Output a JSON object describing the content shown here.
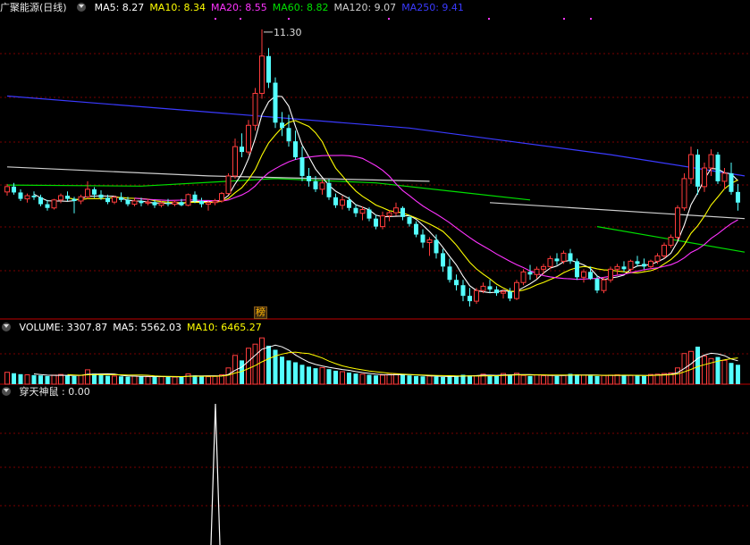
{
  "colors": {
    "up": "#ff3c3c",
    "down": "#54ffff",
    "grid": "#7a0000",
    "separator": "#c00000",
    "ma5": "#ffffff",
    "ma10": "#ffff00",
    "ma20": "#ff33ff",
    "ma60": "#00e000",
    "ma120": "#cfcfcf",
    "ma250": "#3a3aff"
  },
  "price_panel": {
    "title": "广聚能源(日线)",
    "ma_labels": [
      {
        "text": "MA5: 8.27",
        "color": "#ffffff"
      },
      {
        "text": "MA10: 8.34",
        "color": "#ffff00"
      },
      {
        "text": "MA20: 8.55",
        "color": "#ff33ff"
      },
      {
        "text": "MA60: 8.82",
        "color": "#00e000"
      },
      {
        "text": "MA120: 9.07",
        "color": "#cfcfcf"
      },
      {
        "text": "MA250: 9.41",
        "color": "#3a3aff"
      }
    ],
    "high_marker": "11.30",
    "badge": "榜"
  },
  "volume_panel": {
    "labels": [
      {
        "text": "VOLUME: 3307.87",
        "color": "#ffffff"
      },
      {
        "text": "MA5: 5562.03",
        "color": "#ffffff"
      },
      {
        "text": "MA10: 6465.27",
        "color": "#ffff00"
      }
    ]
  },
  "indicator_panel": {
    "label": "穿天神鼠 : 0.00"
  },
  "chart_data": {
    "type": "candlestick",
    "unit_note": "",
    "candles": [
      [
        8.25,
        8.4,
        8.18,
        8.35
      ],
      [
        8.35,
        8.42,
        8.2,
        8.24
      ],
      [
        8.24,
        8.3,
        8.08,
        8.12
      ],
      [
        8.12,
        8.22,
        8.05,
        8.18
      ],
      [
        8.18,
        8.26,
        8.1,
        8.15
      ],
      [
        8.15,
        8.2,
        7.98,
        8.02
      ],
      [
        8.02,
        8.1,
        7.9,
        7.95
      ],
      [
        7.95,
        8.12,
        7.92,
        8.1
      ],
      [
        8.1,
        8.22,
        8.04,
        8.18
      ],
      [
        8.18,
        8.26,
        8.08,
        8.12
      ],
      [
        8.12,
        8.16,
        7.85,
        8.08
      ],
      [
        8.08,
        8.2,
        8.02,
        8.16
      ],
      [
        8.16,
        8.45,
        8.12,
        8.3
      ],
      [
        8.3,
        8.34,
        8.14,
        8.2
      ],
      [
        8.2,
        8.28,
        8.1,
        8.14
      ],
      [
        8.14,
        8.2,
        8.02,
        8.06
      ],
      [
        8.06,
        8.18,
        8.02,
        8.15
      ],
      [
        8.15,
        8.24,
        8.06,
        8.1
      ],
      [
        8.1,
        8.16,
        7.98,
        8.02
      ],
      [
        8.02,
        8.12,
        7.98,
        8.08
      ],
      [
        8.08,
        8.14,
        7.98,
        8.04
      ],
      [
        8.04,
        8.12,
        8.0,
        8.06
      ],
      [
        8.06,
        8.1,
        7.95,
        8.0
      ],
      [
        8.0,
        8.08,
        7.96,
        8.04
      ],
      [
        8.04,
        8.12,
        7.98,
        8.02
      ],
      [
        8.02,
        8.1,
        7.98,
        8.06
      ],
      [
        8.06,
        8.12,
        7.98,
        8.0
      ],
      [
        8.0,
        8.22,
        7.98,
        8.2
      ],
      [
        8.2,
        8.26,
        8.04,
        8.08
      ],
      [
        8.08,
        8.14,
        7.96,
        8.02
      ],
      [
        8.02,
        8.08,
        7.9,
        8.05
      ],
      [
        8.05,
        8.12,
        8.0,
        8.08
      ],
      [
        8.08,
        8.25,
        8.05,
        8.22
      ],
      [
        8.22,
        8.6,
        8.2,
        8.55
      ],
      [
        8.55,
        9.25,
        8.5,
        9.1
      ],
      [
        9.1,
        9.35,
        8.9,
        9.0
      ],
      [
        9.0,
        9.6,
        8.95,
        9.5
      ],
      [
        9.5,
        10.2,
        9.4,
        10.1
      ],
      [
        10.1,
        11.3,
        10.0,
        10.8
      ],
      [
        10.8,
        10.95,
        10.2,
        10.3
      ],
      [
        10.3,
        10.4,
        9.45,
        9.55
      ],
      [
        9.55,
        9.75,
        9.3,
        9.45
      ],
      [
        9.45,
        9.7,
        9.1,
        9.2
      ],
      [
        9.2,
        9.4,
        8.85,
        8.9
      ],
      [
        8.9,
        9.1,
        8.45,
        8.55
      ],
      [
        8.55,
        8.7,
        8.35,
        8.45
      ],
      [
        8.45,
        8.55,
        8.25,
        8.3
      ],
      [
        8.3,
        8.48,
        8.2,
        8.42
      ],
      [
        8.42,
        8.5,
        8.1,
        8.15
      ],
      [
        8.15,
        8.22,
        7.95,
        8.0
      ],
      [
        8.0,
        8.18,
        7.92,
        8.1
      ],
      [
        8.1,
        8.16,
        7.9,
        7.95
      ],
      [
        7.95,
        8.02,
        7.78,
        7.85
      ],
      [
        7.85,
        7.98,
        7.72,
        7.92
      ],
      [
        7.92,
        7.96,
        7.7,
        7.75
      ],
      [
        7.75,
        7.82,
        7.55,
        7.6
      ],
      [
        7.6,
        7.88,
        7.55,
        7.8
      ],
      [
        7.8,
        7.9,
        7.7,
        7.86
      ],
      [
        7.86,
        8.05,
        7.8,
        7.95
      ],
      [
        7.95,
        7.98,
        7.72,
        7.78
      ],
      [
        7.78,
        7.82,
        7.6,
        7.65
      ],
      [
        7.65,
        7.7,
        7.4,
        7.45
      ],
      [
        7.45,
        7.55,
        7.2,
        7.3
      ],
      [
        7.3,
        7.4,
        7.05,
        7.35
      ],
      [
        7.35,
        7.45,
        7.0,
        7.1
      ],
      [
        7.1,
        7.18,
        6.75,
        6.85
      ],
      [
        6.85,
        7.0,
        6.55,
        6.6
      ],
      [
        6.6,
        6.7,
        6.4,
        6.5
      ],
      [
        6.5,
        6.6,
        6.2,
        6.3
      ],
      [
        6.3,
        6.45,
        6.1,
        6.2
      ],
      [
        6.2,
        6.45,
        6.15,
        6.4
      ],
      [
        6.4,
        6.55,
        6.35,
        6.48
      ],
      [
        6.48,
        6.6,
        6.35,
        6.42
      ],
      [
        6.42,
        6.48,
        6.3,
        6.35
      ],
      [
        6.35,
        6.42,
        6.25,
        6.38
      ],
      [
        6.38,
        6.45,
        6.2,
        6.25
      ],
      [
        6.25,
        6.6,
        6.22,
        6.55
      ],
      [
        6.55,
        6.8,
        6.5,
        6.75
      ],
      [
        6.75,
        6.88,
        6.6,
        6.7
      ],
      [
        6.7,
        6.85,
        6.62,
        6.8
      ],
      [
        6.8,
        6.9,
        6.7,
        6.85
      ],
      [
        6.85,
        7.05,
        6.8,
        7.0
      ],
      [
        7.0,
        7.1,
        6.88,
        6.95
      ],
      [
        6.95,
        7.15,
        6.9,
        7.1
      ],
      [
        7.1,
        7.18,
        6.9,
        6.95
      ],
      [
        6.95,
        7.0,
        6.6,
        6.65
      ],
      [
        6.65,
        6.8,
        6.55,
        6.75
      ],
      [
        6.75,
        6.85,
        6.6,
        6.62
      ],
      [
        6.62,
        6.68,
        6.35,
        6.4
      ],
      [
        6.4,
        6.65,
        6.35,
        6.6
      ],
      [
        6.6,
        6.85,
        6.55,
        6.8
      ],
      [
        6.8,
        6.9,
        6.7,
        6.85
      ],
      [
        6.85,
        6.95,
        6.75,
        6.8
      ],
      [
        6.8,
        6.98,
        6.75,
        6.95
      ],
      [
        6.95,
        7.05,
        6.85,
        6.9
      ],
      [
        6.9,
        7.0,
        6.8,
        6.85
      ],
      [
        6.85,
        6.98,
        6.8,
        6.95
      ],
      [
        6.95,
        7.1,
        6.9,
        7.05
      ],
      [
        7.05,
        7.3,
        7.0,
        7.25
      ],
      [
        7.25,
        7.45,
        7.2,
        7.4
      ],
      [
        7.4,
        8.0,
        7.35,
        7.95
      ],
      [
        7.95,
        8.6,
        7.9,
        8.5
      ],
      [
        8.5,
        9.1,
        8.4,
        8.95
      ],
      [
        8.95,
        9.05,
        8.2,
        8.35
      ],
      [
        8.35,
        8.8,
        8.25,
        8.7
      ],
      [
        8.7,
        9.05,
        8.55,
        8.95
      ],
      [
        8.95,
        9.0,
        8.4,
        8.45
      ],
      [
        8.45,
        8.7,
        8.3,
        8.6
      ],
      [
        8.6,
        8.8,
        8.2,
        8.25
      ],
      [
        8.25,
        8.4,
        7.9,
        8.05
      ]
    ],
    "volumes": [
      3800,
      3500,
      3200,
      3000,
      2900,
      2800,
      2600,
      2900,
      3100,
      2700,
      2600,
      2800,
      4600,
      3400,
      3000,
      2700,
      2600,
      2500,
      2400,
      2600,
      2500,
      2400,
      2300,
      2400,
      2500,
      2300,
      2400,
      3300,
      2800,
      2500,
      2400,
      2500,
      3000,
      5200,
      9200,
      7600,
      11500,
      12800,
      14800,
      12300,
      11000,
      8800,
      7600,
      7000,
      6200,
      5600,
      5100,
      5300,
      4800,
      4300,
      4000,
      3700,
      3400,
      3200,
      3000,
      2800,
      2900,
      3100,
      3300,
      3000,
      2800,
      2600,
      2500,
      2600,
      2400,
      2300,
      2500,
      2700,
      3000,
      2800,
      2700,
      3200,
      2800,
      2600,
      3400,
      3000,
      3500,
      2800,
      2600,
      3000,
      2700,
      2900,
      2600,
      2800,
      3300,
      3100,
      2900,
      2700,
      2600,
      2800,
      2900,
      3000,
      2700,
      2800,
      2900,
      2600,
      3100,
      3200,
      3400,
      3600,
      5200,
      9800,
      10500,
      12000,
      9000,
      8200,
      8700,
      7600,
      6800,
      6200
    ],
    "ma_lines": [
      {
        "name": "MA5",
        "color": "#ffffff",
        "window": 5
      },
      {
        "name": "MA10",
        "color": "#ffff00",
        "window": 10
      },
      {
        "name": "MA20",
        "color": "#ff33ff",
        "window": 20
      },
      {
        "name": "MA60",
        "color": "#00e000",
        "segments": [
          [
            0,
            8.38
          ],
          [
            20,
            8.36
          ],
          [
            40,
            8.5
          ],
          [
            55,
            8.42
          ],
          [
            78,
            8.1
          ]
        ],
        "segments2": [
          [
            88,
            7.6
          ],
          [
            110,
            7.12
          ]
        ]
      },
      {
        "name": "MA120",
        "color": "#cfcfcf",
        "segments": [
          [
            0,
            8.72
          ],
          [
            30,
            8.55
          ],
          [
            63,
            8.45
          ]
        ],
        "segments2": [
          [
            72,
            8.05
          ],
          [
            110,
            7.75
          ]
        ]
      },
      {
        "name": "MA250",
        "color": "#3a3aff",
        "segments": [
          [
            0,
            10.05
          ],
          [
            30,
            9.75
          ],
          [
            60,
            9.45
          ],
          [
            90,
            8.95
          ],
          [
            110,
            8.55
          ]
        ]
      }
    ],
    "volume_ma": [
      {
        "name": "MA5",
        "color": "#ffffff",
        "window": 5
      },
      {
        "name": "MA10",
        "color": "#ffff00",
        "window": 10
      }
    ],
    "indicator": {
      "values_spike_index": 34,
      "spike_value": 1.0
    }
  }
}
